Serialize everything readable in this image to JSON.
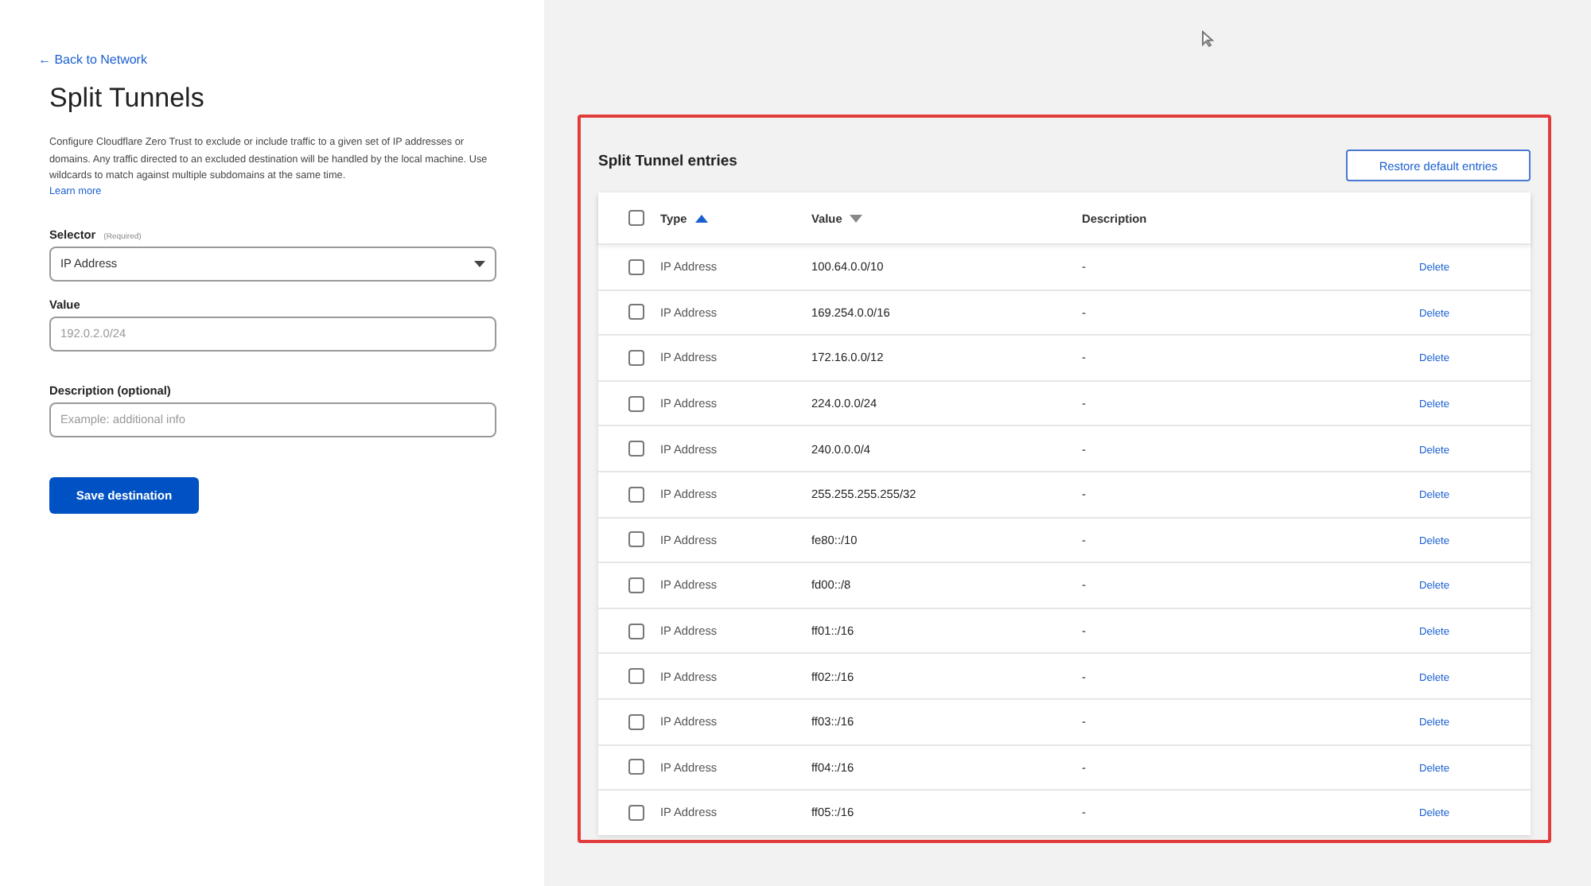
{
  "back_link": "← Back to Network",
  "title": "Split Tunnels",
  "description": "Configure Cloudflare Zero Trust to exclude or include traffic to a given set of IP addresses or domains. Any traffic directed to an excluded destination will be handled by the local machine. Use wildcards to match against multiple subdomains at the same time.",
  "learn_more": "Learn more",
  "form": {
    "selector": {
      "label": "Selector",
      "hint": "(Required)",
      "value": "IP Address"
    },
    "value": {
      "label": "Value",
      "placeholder": "192.0.2.0/24"
    },
    "description": {
      "label": "Description (optional)",
      "placeholder": "Example: additional info"
    },
    "submit": "Save destination"
  },
  "entries": {
    "title": "Split Tunnel entries",
    "restore_button": "Restore default entries",
    "columns": [
      {
        "label": "Type",
        "sorted": true,
        "descending": false
      },
      {
        "label": "Value",
        "sorted": false,
        "descending": true
      },
      {
        "label": "Description"
      }
    ],
    "all_checked": false,
    "rows": [
      {
        "type": "IP Address",
        "value": "100.64.0.0/10",
        "description": "-",
        "action": "Delete",
        "checked": false
      },
      {
        "type": "IP Address",
        "value": "169.254.0.0/16",
        "description": "-",
        "action": "Delete",
        "checked": false
      },
      {
        "type": "IP Address",
        "value": "172.16.0.0/12",
        "description": "-",
        "action": "Delete",
        "checked": false
      },
      {
        "type": "IP Address",
        "value": "224.0.0.0/24",
        "description": "-",
        "action": "Delete",
        "checked": false
      },
      {
        "type": "IP Address",
        "value": "240.0.0.0/4",
        "description": "-",
        "action": "Delete",
        "checked": false
      },
      {
        "type": "IP Address",
        "value": "255.255.255.255/32",
        "description": "-",
        "action": "Delete",
        "checked": false
      },
      {
        "type": "IP Address",
        "value": "fe80::/10",
        "description": "-",
        "action": "Delete",
        "checked": false
      },
      {
        "type": "IP Address",
        "value": "fd00::/8",
        "description": "-",
        "action": "Delete",
        "checked": false
      },
      {
        "type": "IP Address",
        "value": "ff01::/16",
        "description": "-",
        "action": "Delete",
        "checked": false
      },
      {
        "type": "IP Address",
        "value": "ff02::/16",
        "description": "-",
        "action": "Delete",
        "checked": false
      },
      {
        "type": "IP Address",
        "value": "ff03::/16",
        "description": "-",
        "action": "Delete",
        "checked": false
      },
      {
        "type": "IP Address",
        "value": "ff04::/16",
        "description": "-",
        "action": "Delete",
        "checked": false
      },
      {
        "type": "IP Address",
        "value": "ff05::/16",
        "description": "-",
        "action": "Delete",
        "checked": false
      }
    ]
  }
}
